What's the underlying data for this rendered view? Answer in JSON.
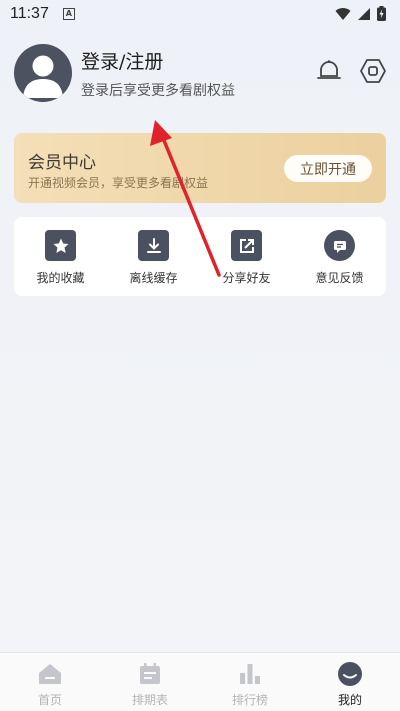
{
  "status": {
    "time": "11:37",
    "a_label": "A"
  },
  "profile": {
    "title": "登录/注册",
    "subtitle": "登录后享受更多看剧权益"
  },
  "member": {
    "title": "会员中心",
    "subtitle": "开通视频会员，享受更多看剧权益",
    "button": "立即开通"
  },
  "actions": [
    {
      "label": "我的收藏",
      "icon": "star-icon"
    },
    {
      "label": "离线缓存",
      "icon": "download-icon"
    },
    {
      "label": "分享好友",
      "icon": "share-icon"
    },
    {
      "label": "意见反馈",
      "icon": "feedback-icon"
    }
  ],
  "nav": [
    {
      "label": "首页",
      "icon": "home-icon",
      "active": false
    },
    {
      "label": "排期表",
      "icon": "calendar-icon",
      "active": false
    },
    {
      "label": "排行榜",
      "icon": "chart-icon",
      "active": false
    },
    {
      "label": "我的",
      "icon": "profile-icon",
      "active": true
    }
  ],
  "colors": {
    "accent_arrow": "#e0222b",
    "member_gold": "#ecd09e",
    "icon_dark": "#4b5160"
  }
}
